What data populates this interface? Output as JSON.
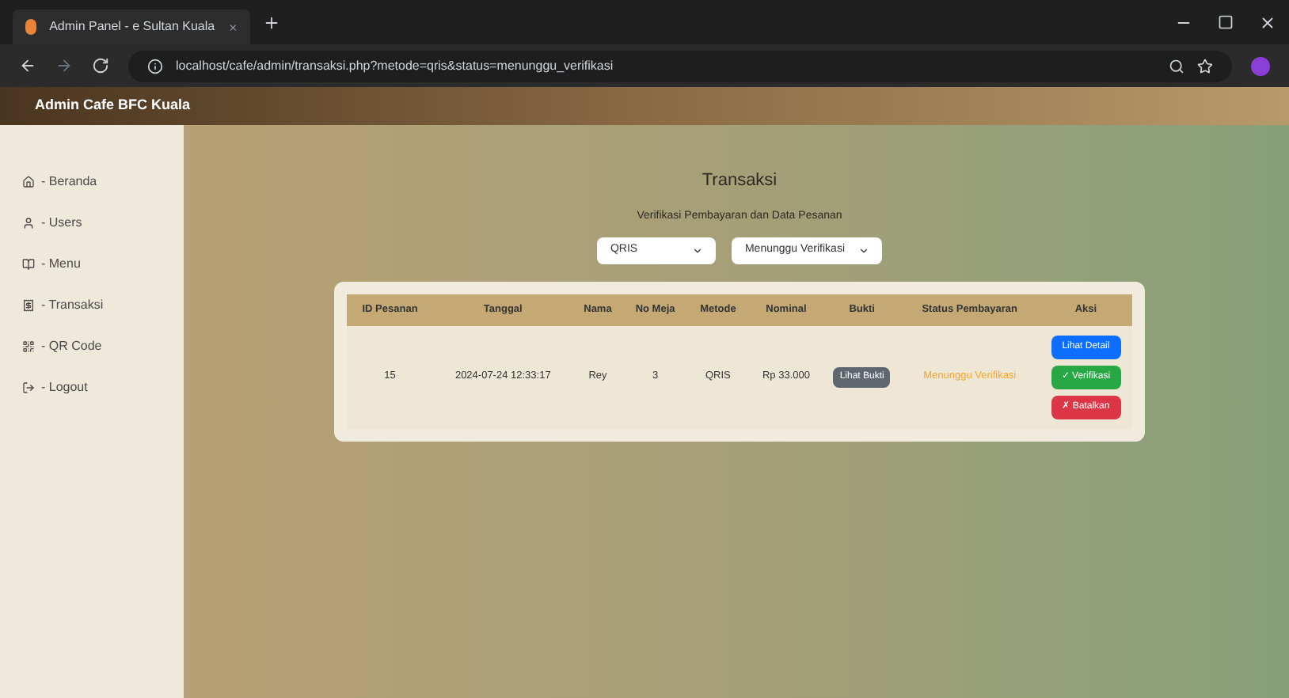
{
  "browser": {
    "tab_title": "Admin Panel - e Sultan Kuala",
    "url": "localhost/cafe/admin/transaksi.php?metode=qris&status=menunggu_verifikasi"
  },
  "app_title": "Admin Cafe BFC Kuala",
  "sidebar": {
    "items": [
      {
        "kind": "home",
        "label": "- Beranda"
      },
      {
        "kind": "user",
        "label": "- Users"
      },
      {
        "kind": "menu",
        "label": "- Menu"
      },
      {
        "kind": "transaction",
        "label": "- Transaksi"
      },
      {
        "kind": "qr",
        "label": "- QR Code"
      },
      {
        "kind": "logout",
        "label": "- Logout"
      }
    ]
  },
  "page": {
    "title": "Transaksi",
    "subtitle": "Verifikasi Pembayaran dan Data Pesanan",
    "filters": [
      {
        "value": "QRIS"
      },
      {
        "value": "Menunggu Verifikasi"
      }
    ]
  },
  "table": {
    "columns": [
      "ID Pesanan",
      "Tanggal",
      "Nama",
      "No Meja",
      "Metode",
      "Nominal",
      "Bukti",
      "Status Pembayaran",
      "Aksi"
    ],
    "rows": [
      {
        "id": "15",
        "date": "2024-07-24 12:33:17",
        "name": "Rey",
        "table_no": "3",
        "method": "QRIS",
        "amount": "Rp 33.000",
        "proof_button": "Lihat Bukti",
        "status": "Menunggu Verifikasi",
        "actions": [
          {
            "kind": "detail",
            "label": "Lihat Detail"
          },
          {
            "kind": "verify",
            "label": "✓ Verifikasi"
          },
          {
            "kind": "cancel",
            "label": "✗ Batalkan"
          }
        ]
      }
    ]
  }
}
